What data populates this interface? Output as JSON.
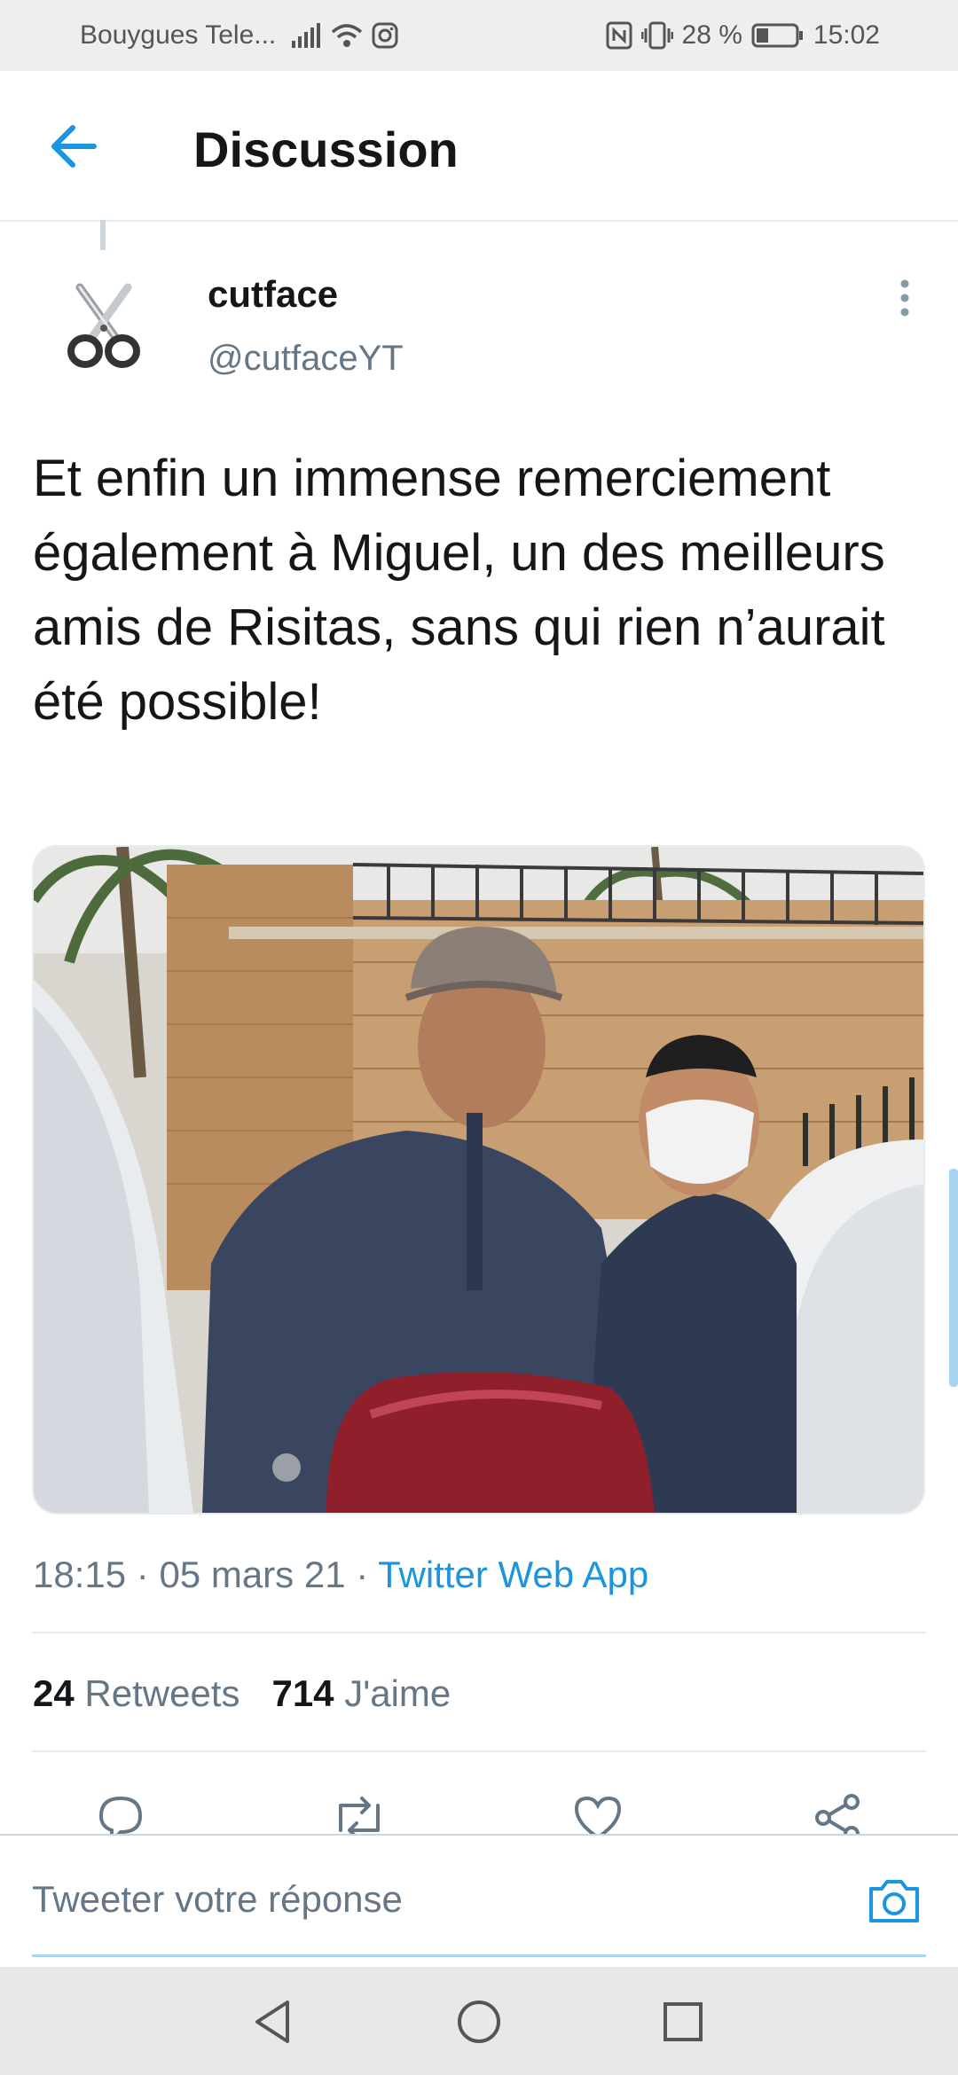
{
  "status_bar": {
    "carrier": "Bouygues Tele...",
    "battery": "28 %",
    "time": "15:02",
    "icons": [
      "signal-icon",
      "wifi-icon",
      "instagram-icon",
      "nfc-icon",
      "vibrate-icon",
      "battery-icon"
    ]
  },
  "header": {
    "title": "Discussion",
    "back_icon": "arrow-left-icon"
  },
  "tweet": {
    "author_name": "cutface",
    "author_handle": "@cutfaceYT",
    "avatar_icon": "scissors-icon",
    "text": "Et enfin un immense remerciement également à Miguel, un des meilleurs amis de Risitas, sans qui rien n’aurait été possible!",
    "time": "18:15",
    "date": "05 mars 21",
    "separator": "·",
    "source": "Twitter Web App",
    "retweets_count": "24",
    "retweets_label": "Retweets",
    "likes_count": "714",
    "likes_label": "J'aime"
  },
  "actions": [
    "reply-icon",
    "retweet-icon",
    "like-icon",
    "share-icon"
  ],
  "reply_bar": {
    "placeholder": "Tweeter votre réponse",
    "camera_icon": "camera-icon"
  },
  "nav": [
    "back-triangle-icon",
    "home-circle-icon",
    "recents-square-icon"
  ],
  "colors": {
    "accent": "#1b95e0",
    "text": "#14171a",
    "muted": "#657786",
    "divider": "#e6ecf0"
  }
}
